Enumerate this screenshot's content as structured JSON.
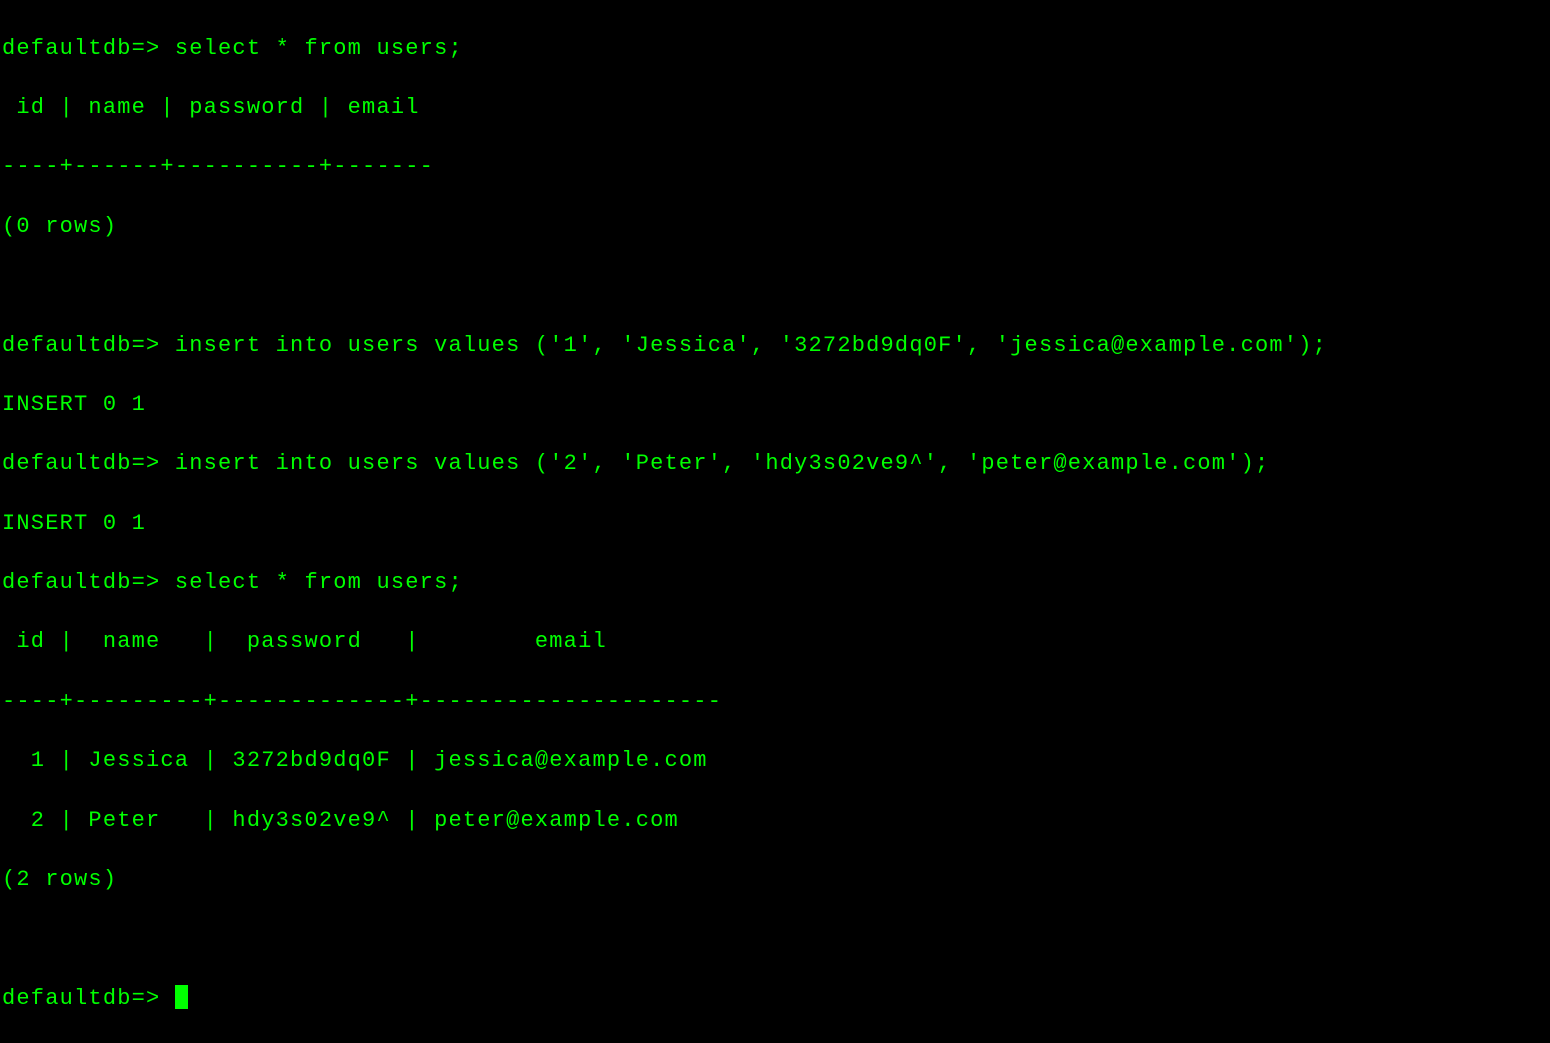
{
  "terminal": {
    "prompt": "defaultdb=> ",
    "session": {
      "block1": {
        "prompt_line": "defaultdb=> select * from users;",
        "header": " id | name | password | email ",
        "divider": "----+------+----------+-------",
        "rowcount": "(0 rows)"
      },
      "block2": {
        "insert1_line": "defaultdb=> insert into users values ('1', 'Jessica', '3272bd9dq0F', 'jessica@example.com');",
        "insert1_resp": "INSERT 0 1",
        "insert2_line": "defaultdb=> insert into users values ('2', 'Peter', 'hdy3s02ve9^', 'peter@example.com');",
        "insert2_resp": "INSERT 0 1"
      },
      "block3": {
        "prompt_line": "defaultdb=> select * from users;",
        "header": " id |  name   |  password   |        email        ",
        "divider": "----+---------+-------------+---------------------",
        "row1": "  1 | Jessica | 3272bd9dq0F | jessica@example.com",
        "row2": "  2 | Peter   | hdy3s02ve9^ | peter@example.com",
        "rowcount": "(2 rows)"
      },
      "final_prompt": "defaultdb=> "
    }
  }
}
